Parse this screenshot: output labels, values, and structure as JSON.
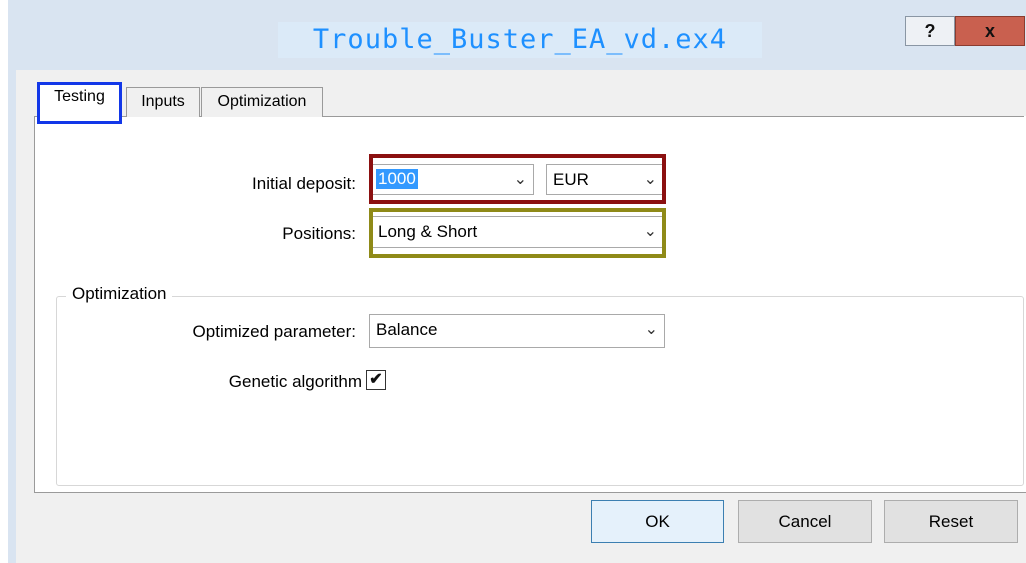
{
  "window": {
    "title": "Trouble_Buster_EA_vd.ex4",
    "help_label": "?",
    "close_label": "x"
  },
  "tabs": [
    {
      "label": "Testing",
      "active": true
    },
    {
      "label": "Inputs",
      "active": false
    },
    {
      "label": "Optimization",
      "active": false
    }
  ],
  "testing": {
    "initial_deposit_label": "Initial deposit:",
    "initial_deposit_value": "1000",
    "currency_value": "EUR",
    "positions_label": "Positions:",
    "positions_value": "Long & Short"
  },
  "optimization": {
    "group_title": "Optimization",
    "parameter_label": "Optimized parameter:",
    "parameter_value": "Balance",
    "genetic_label": "Genetic algorithm",
    "genetic_checked": true,
    "check_mark": "✔"
  },
  "buttons": {
    "ok": "OK",
    "cancel": "Cancel",
    "reset": "Reset"
  },
  "dropdown_arrow": "⌄",
  "colors": {
    "title_text": "#1e90ff",
    "tab_highlight": "#1237e8",
    "deposit_highlight": "#8b1010",
    "positions_highlight": "#8f8a18"
  }
}
